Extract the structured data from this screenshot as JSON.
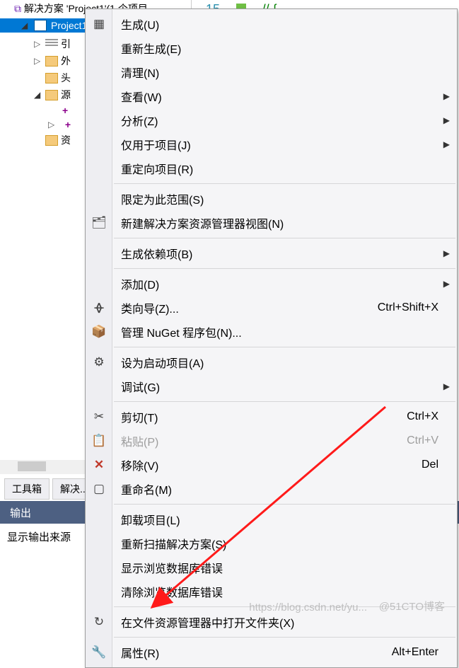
{
  "code": {
    "line_num": "15",
    "frag": "//    {"
  },
  "solution": {
    "root": "解决方案 'Project1'(1 个项目",
    "project": "Project1",
    "nodes": {
      "refs": "引",
      "ext": "外",
      "hdr": "头",
      "src": "源",
      "plus1": "+",
      "plus2": "+",
      "res": "资"
    }
  },
  "tabs": {
    "toolbox": "工具箱",
    "solution_explorer": "解决..."
  },
  "output": {
    "header": "输出",
    "label": "显示输出来源"
  },
  "menu": {
    "build": "生成(U)",
    "rebuild": "重新生成(E)",
    "clean": "清理(N)",
    "view": "查看(W)",
    "analyze": "分析(Z)",
    "project_only": "仅用于项目(J)",
    "retarget": "重定向项目(R)",
    "scope": "限定为此范围(S)",
    "new_explorer": "新建解决方案资源管理器视图(N)",
    "build_deps": "生成依赖项(B)",
    "add": "添加(D)",
    "class_wizard": "类向导(Z)...",
    "class_wizard_sc": "Ctrl+Shift+X",
    "nuget": "管理 NuGet 程序包(N)...",
    "set_startup": "设为启动项目(A)",
    "debug": "调试(G)",
    "cut": "剪切(T)",
    "cut_sc": "Ctrl+X",
    "paste": "粘贴(P)",
    "paste_sc": "Ctrl+V",
    "remove": "移除(V)",
    "remove_sc": "Del",
    "rename": "重命名(M)",
    "unload": "卸载项目(L)",
    "rescan": "重新扫描解决方案(S)",
    "browse_db_err": "显示浏览数据库错误",
    "clear_browse_db_err": "清除浏览数据库错误",
    "open_folder": "在文件资源管理器中打开文件夹(X)",
    "properties": "属性(R)",
    "properties_sc": "Alt+Enter"
  },
  "watermarks": {
    "w1": "https://blog.csdn.net/yu...",
    "w2": "@51CTO博客"
  }
}
